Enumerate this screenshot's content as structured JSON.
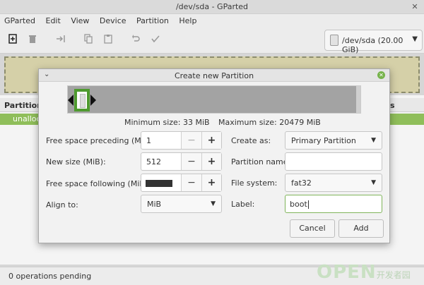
{
  "window": {
    "title": "/dev/sda - GParted",
    "close_glyph": "✕"
  },
  "menubar": {
    "items": [
      "GParted",
      "Edit",
      "View",
      "Device",
      "Partition",
      "Help"
    ]
  },
  "device": {
    "label": "/dev/sda (20.00 GiB)"
  },
  "graph": {
    "label": "unallocated"
  },
  "list": {
    "column_partition": "Partition",
    "column_flags_tail": "s",
    "row_name": "unallocated"
  },
  "status": {
    "text": "0 operations pending"
  },
  "watermark": {
    "text": "OPEN",
    "subtext": "开发者园"
  },
  "dialog": {
    "title": "Create new Partition",
    "min_size": "Minimum size: 33 MiB",
    "max_size": "Maximum size: 20479 MiB",
    "free_preceding": {
      "label": "Free space preceding (MiB):",
      "value": "1"
    },
    "new_size": {
      "label": "New size (MiB):",
      "value": "512"
    },
    "free_following": {
      "label": "Free space following (MiB):"
    },
    "align": {
      "label": "Align to:",
      "value": "MiB"
    },
    "create_as": {
      "label": "Create as:",
      "value": "Primary Partition"
    },
    "partition_name": {
      "label": "Partition name:",
      "value": ""
    },
    "file_system": {
      "label": "File system:",
      "value": "fat32"
    },
    "label": {
      "label": "Label:",
      "value": "boot"
    },
    "cancel": "Cancel",
    "add": "Add"
  },
  "colors": {
    "accent": "#4e9a2f",
    "unallocated_row": "#8fbe5a",
    "graph_bg": "#d5d0a8"
  }
}
